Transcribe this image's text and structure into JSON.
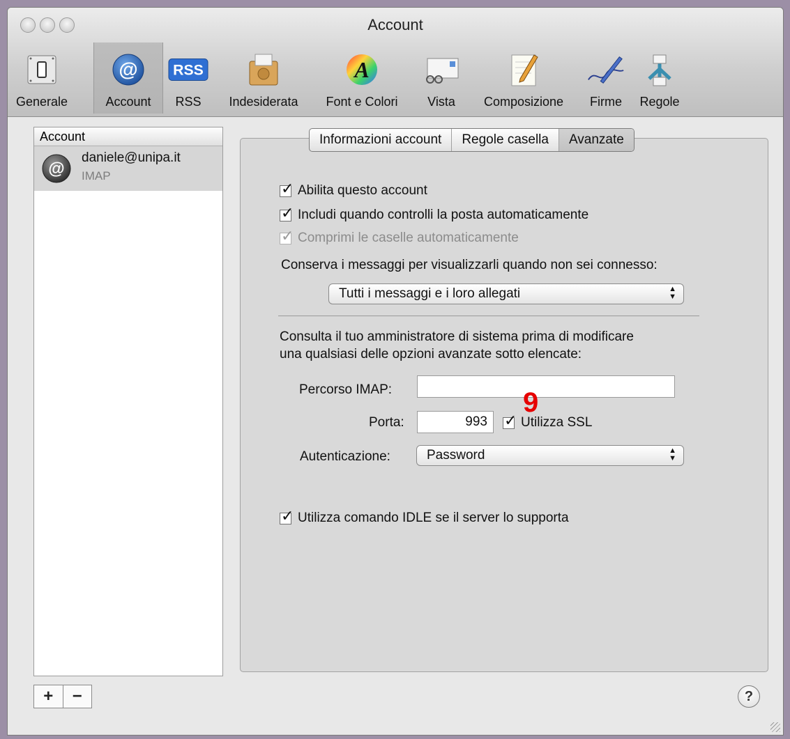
{
  "window": {
    "title": "Account"
  },
  "toolbar": {
    "items": [
      {
        "label": "Generale",
        "icon": "switch-icon"
      },
      {
        "label": "Account",
        "icon": "at-icon"
      },
      {
        "label": "RSS",
        "icon": "rss-icon"
      },
      {
        "label": "Indesiderata",
        "icon": "junk-mail-icon"
      },
      {
        "label": "Font e Colori",
        "icon": "font-colors-icon"
      },
      {
        "label": "Vista",
        "icon": "view-icon"
      },
      {
        "label": "Composizione",
        "icon": "compose-icon"
      },
      {
        "label": "Firme",
        "icon": "signature-icon"
      },
      {
        "label": "Regole",
        "icon": "rules-icon"
      }
    ],
    "selected": "Account",
    "rss_badge": "RSS",
    "at_glyph": "@"
  },
  "accounts": {
    "header": "Account",
    "items": [
      {
        "email": "daniele@unipa.it",
        "type": "IMAP"
      }
    ],
    "add_label": "+",
    "remove_label": "−"
  },
  "tabs": [
    {
      "label": "Informazioni account",
      "active": false
    },
    {
      "label": "Regole casella",
      "active": false
    },
    {
      "label": "Avanzate",
      "active": true
    }
  ],
  "advanced": {
    "enable_account": {
      "label": "Abilita questo account",
      "checked": true
    },
    "include_auto_check": {
      "label": "Includi quando controlli la posta automaticamente",
      "checked": true
    },
    "compact_mailboxes": {
      "label": "Comprimi le caselle automaticamente",
      "checked": true,
      "disabled": true
    },
    "keep_copies_label": "Conserva i messaggi per visualizzarli quando non sei connesso:",
    "keep_copies_value": "Tutti i messaggi e i loro allegati",
    "warning_line1": "Consulta il tuo amministratore di sistema prima di modificare",
    "warning_line2": "una qualsiasi delle opzioni avanzate sotto elencate:",
    "imap_path_label": "Percorso IMAP:",
    "imap_path_value": "",
    "port_label": "Porta:",
    "port_value": "993",
    "use_ssl": {
      "label": "Utilizza SSL",
      "checked": true
    },
    "auth_label": "Autenticazione:",
    "auth_value": "Password",
    "idle": {
      "label": "Utilizza comando IDLE se il server lo supporta",
      "checked": true
    }
  },
  "annotation": "9",
  "help_label": "?",
  "check_glyph": "✓",
  "popup_arrows": "▲▼",
  "colors": {
    "annotation": "#e60000",
    "window_bg": "#e8e8e8",
    "panel_bg": "#d9d9d9",
    "desktop": "#9c8fa6"
  }
}
